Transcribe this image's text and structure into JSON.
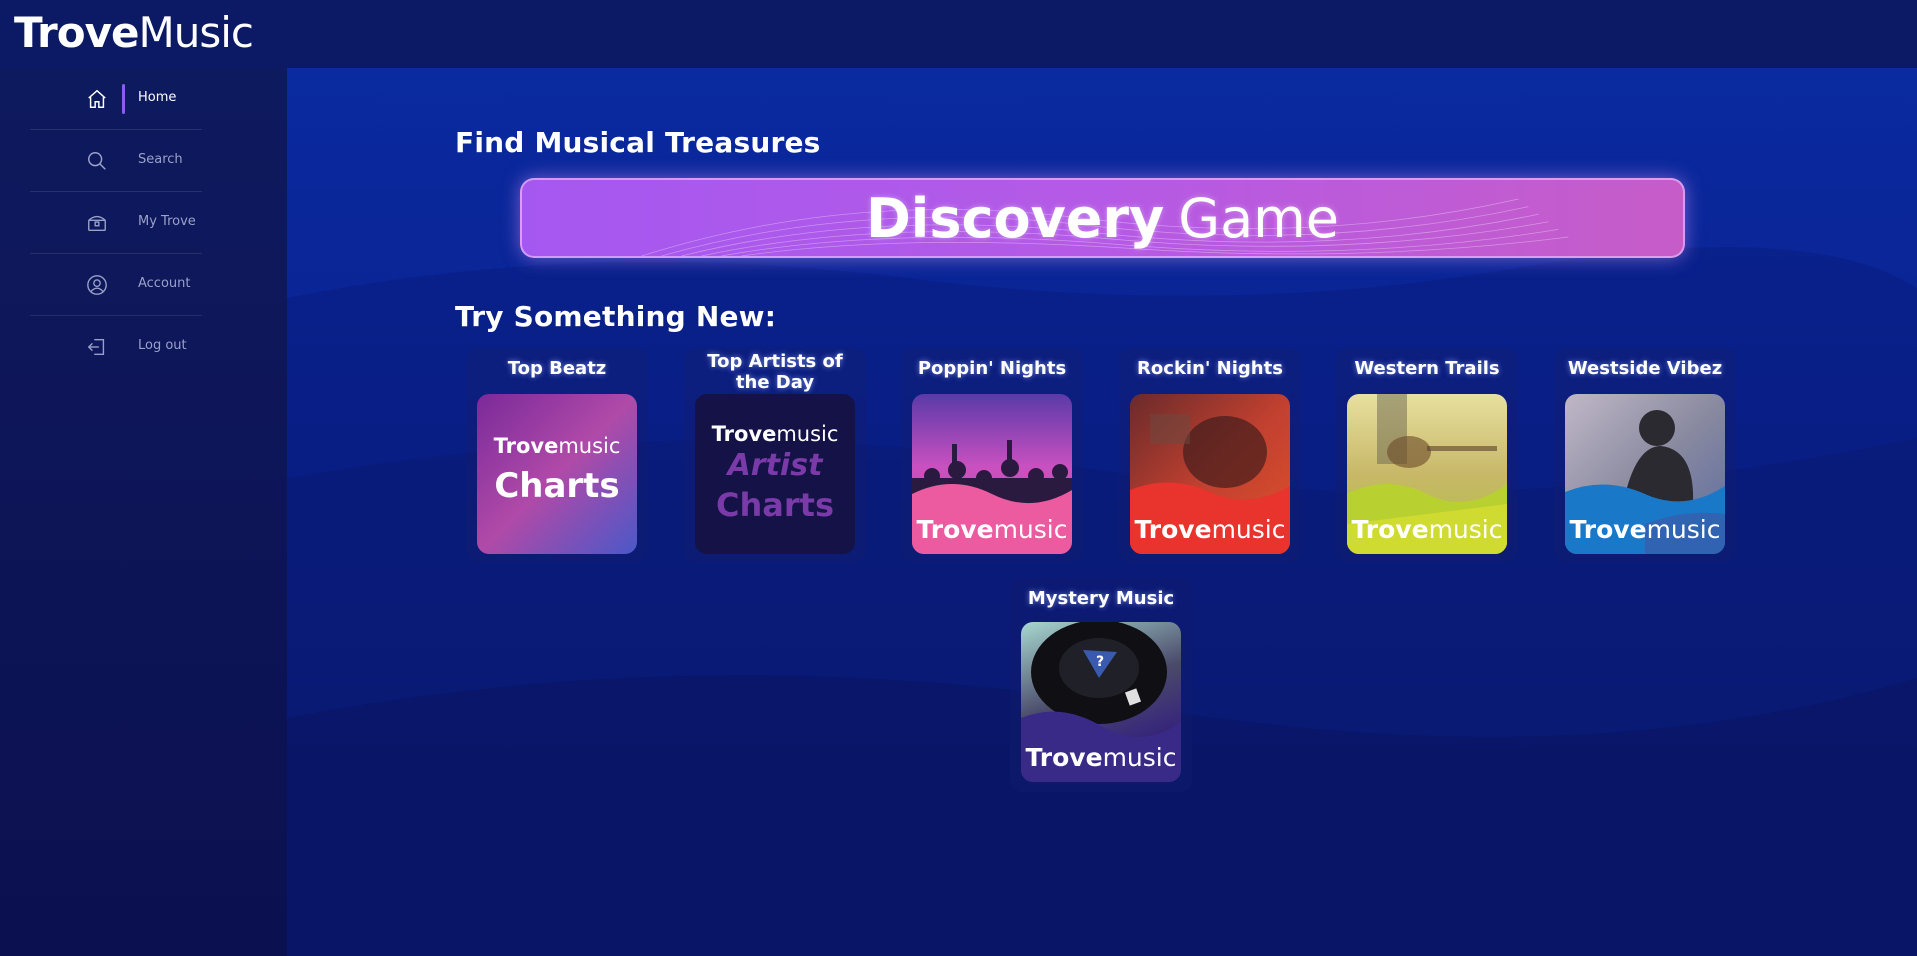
{
  "app": {
    "logo_bold": "Trove",
    "logo_light": "Music"
  },
  "sidebar": {
    "items": [
      {
        "label": "Home",
        "icon": "home-icon",
        "active": true
      },
      {
        "label": "Search",
        "icon": "search-icon",
        "active": false
      },
      {
        "label": "My Trove",
        "icon": "treasure-chest-icon",
        "active": false
      },
      {
        "label": "Account",
        "icon": "account-icon",
        "active": false
      },
      {
        "label": "Log out",
        "icon": "logout-icon",
        "active": false
      }
    ]
  },
  "main": {
    "find_title": "Find Musical Treasures",
    "banner": {
      "bold": "Discovery",
      "light": "Game"
    },
    "try_title": "Try Something New:",
    "brand_bold": "Trove",
    "brand_light": "music",
    "cards": [
      {
        "title": "Top Beatz",
        "art": "Charts"
      },
      {
        "title": "Top Artists of the Day",
        "art_line1": "Artist",
        "art_line2": "Charts"
      },
      {
        "title": "Poppin' Nights"
      },
      {
        "title": "Rockin' Nights"
      },
      {
        "title": "Western Trails"
      },
      {
        "title": "Westside Vibez"
      },
      {
        "title": "Mystery Music",
        "badge": "?"
      }
    ]
  },
  "colors": {
    "accent": "#8a5cf0",
    "banner_start": "#a558f0",
    "banner_end": "#c65cc8",
    "sidebar_bg": "#0d1456",
    "main_bg": "#0a2596"
  }
}
